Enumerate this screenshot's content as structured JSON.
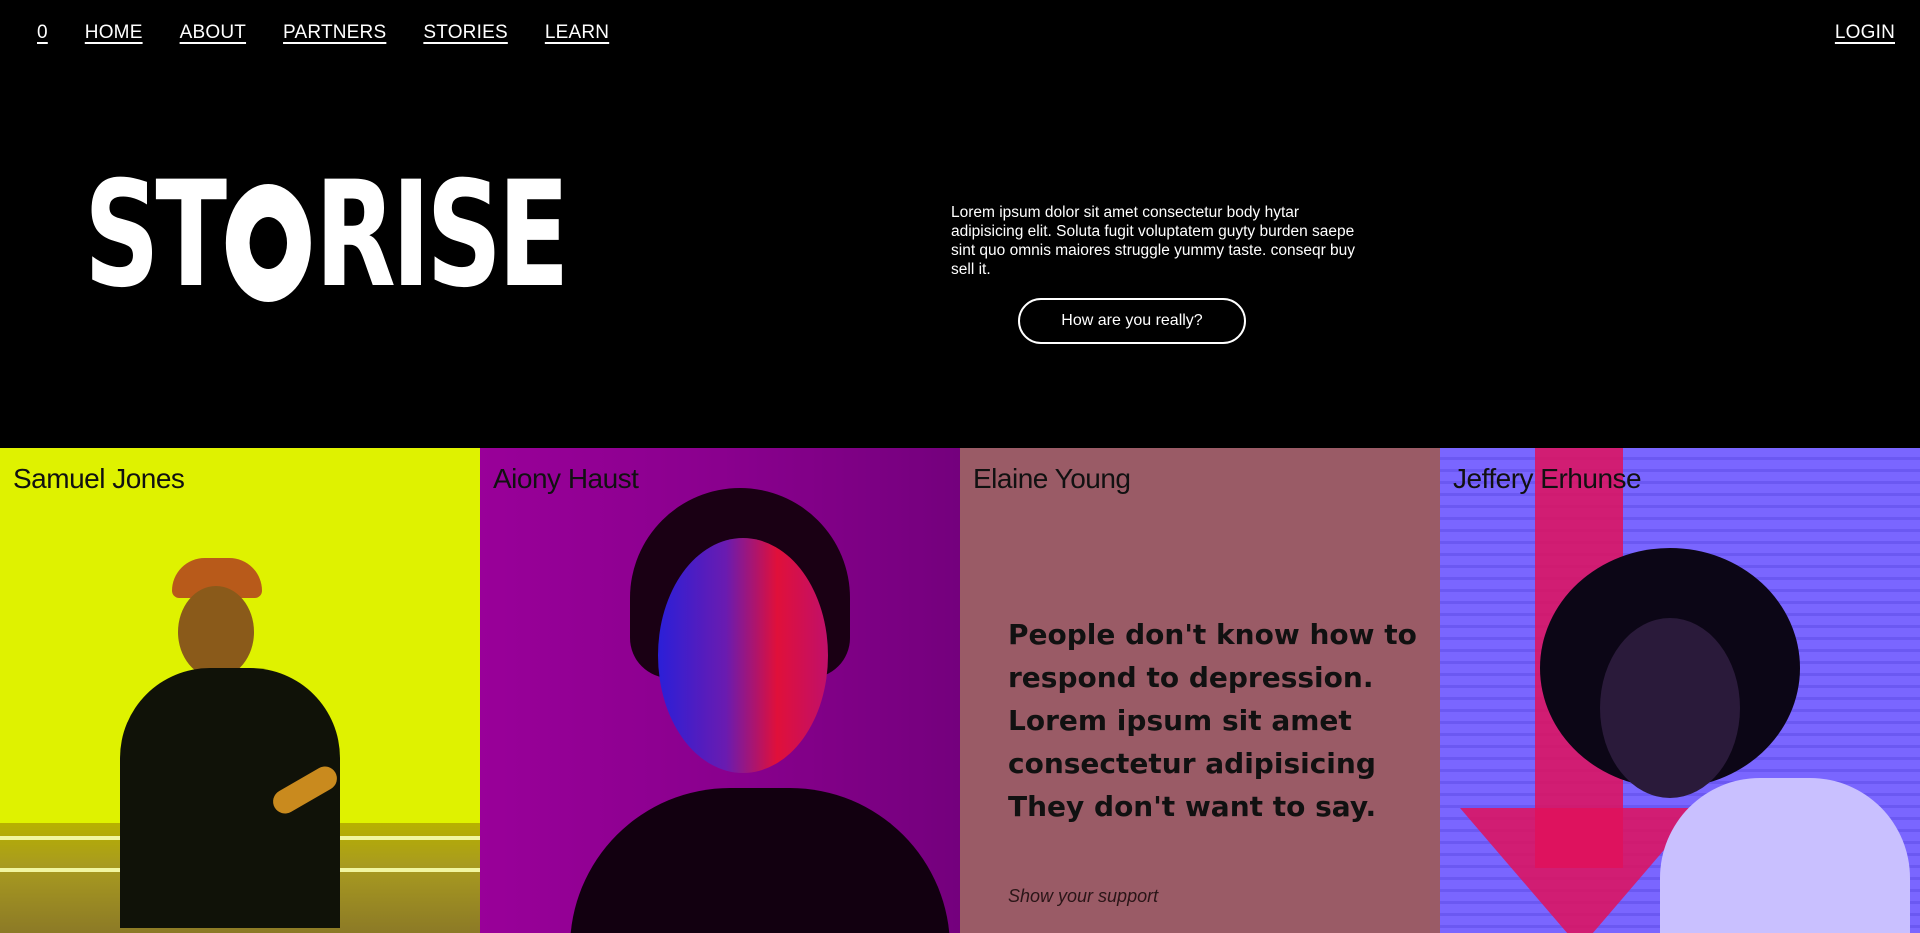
{
  "nav": {
    "counter": "0",
    "items": [
      "HOME",
      "ABOUT",
      "PARTNERS",
      "STORIES",
      "LEARN"
    ],
    "login": "LOGIN"
  },
  "hero": {
    "title_start": "ST",
    "title_end": "RISE",
    "description": "Lorem ipsum dolor sit amet consectetur body hytar adipisicing elit. Soluta fugit voluptatem guyty burden saepe sint quo omnis maiores struggle yummy taste. conseqr buy sell it.",
    "cta": "How are you really?"
  },
  "cards": [
    {
      "name": "Samuel Jones",
      "color": "#dff200"
    },
    {
      "name": "Aiony Haust",
      "color": "#8a008e"
    },
    {
      "name": "Elaine Young",
      "color": "#9a5b66",
      "quote": "People don't know how to respond to depression. Lorem ipsum sit amet consectetur adipisicing They don't want to say.",
      "link": "Show your support"
    },
    {
      "name": "Jeffery Erhunse",
      "color": "#7a66ff"
    }
  ]
}
